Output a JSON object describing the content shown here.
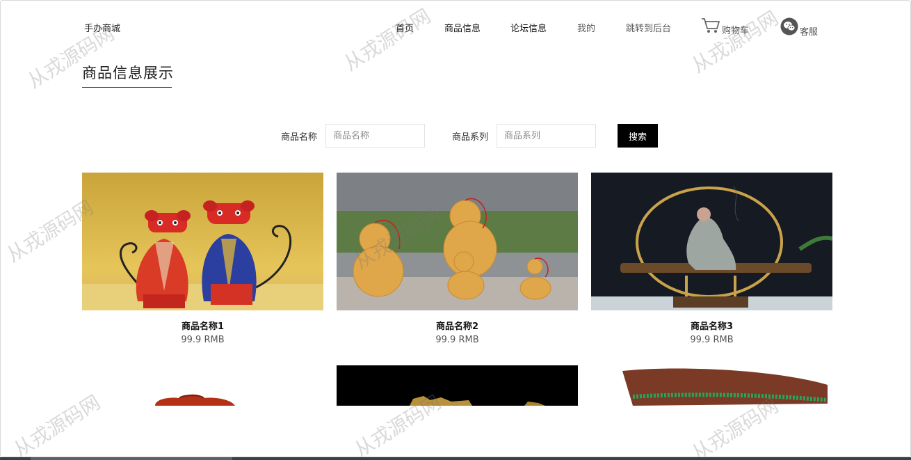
{
  "header": {
    "brand": "手办商城",
    "nav": [
      {
        "label": "首页"
      },
      {
        "label": "商品信息"
      },
      {
        "label": "论坛信息"
      },
      {
        "label": "我的"
      },
      {
        "label": "跳转到后台"
      }
    ],
    "cart_label": "购物车",
    "service_label": "客服"
  },
  "page": {
    "title": "商品信息展示"
  },
  "search": {
    "name_label": "商品名称",
    "name_placeholder": "商品名称",
    "name_value": "",
    "series_label": "商品系列",
    "series_placeholder": "商品系列",
    "series_value": "",
    "button_label": "搜索"
  },
  "products": [
    {
      "name": "商品名称1",
      "price": "99.9 RMB",
      "image": "cat-figurines"
    },
    {
      "name": "商品名称2",
      "price": "99.9 RMB",
      "image": "gourds"
    },
    {
      "name": "商品名称3",
      "price": "99.9 RMB",
      "image": "buddha-incense-statue"
    },
    {
      "name": "",
      "price": "",
      "image": "red-carved-vase"
    },
    {
      "name": "",
      "price": "",
      "image": "gold-dragon-carving"
    },
    {
      "name": "",
      "price": "",
      "image": "brown-bowl"
    }
  ],
  "watermark": "从戎源码网",
  "icons": {
    "cart": "cart-icon",
    "service": "wechat-icon"
  }
}
